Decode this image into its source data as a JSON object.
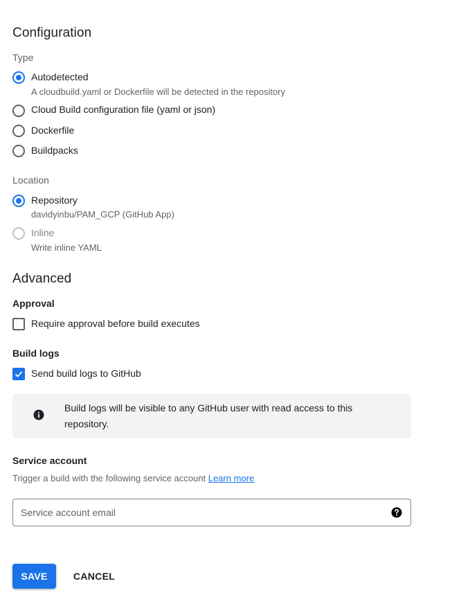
{
  "configuration": {
    "title": "Configuration",
    "type": {
      "label": "Type",
      "options": [
        {
          "label": "Autodetected",
          "description": "A cloudbuild.yaml or Dockerfile will be detected in the repository",
          "selected": true
        },
        {
          "label": "Cloud Build configuration file (yaml or json)",
          "selected": false
        },
        {
          "label": "Dockerfile",
          "selected": false
        },
        {
          "label": "Buildpacks",
          "selected": false
        }
      ]
    },
    "location": {
      "label": "Location",
      "options": [
        {
          "label": "Repository",
          "description": "davidyinbu/PAM_GCP (GitHub App)",
          "selected": true
        },
        {
          "label": "Inline",
          "description": "Write inline YAML",
          "selected": false,
          "disabled": true
        }
      ]
    }
  },
  "advanced": {
    "title": "Advanced",
    "approval": {
      "label": "Approval",
      "checkbox_label": "Require approval before build executes",
      "checked": false
    },
    "build_logs": {
      "label": "Build logs",
      "checkbox_label": "Send build logs to GitHub",
      "checked": true,
      "info_line1": "Build logs will be visible to any GitHub user with read access to this",
      "info_line2": "repository."
    },
    "service_account": {
      "label": "Service account",
      "help_text": "Trigger a build with the following service account",
      "learn_more": "Learn more",
      "input_placeholder": "Service account email",
      "input_value": ""
    }
  },
  "actions": {
    "save_label": "SAVE",
    "cancel_label": "CANCEL"
  },
  "colors": {
    "accent": "#1a73e8",
    "info_bg": "#f1f3f4"
  },
  "icons": {
    "info": "info-icon",
    "help": "help-icon",
    "check": "check-icon"
  }
}
